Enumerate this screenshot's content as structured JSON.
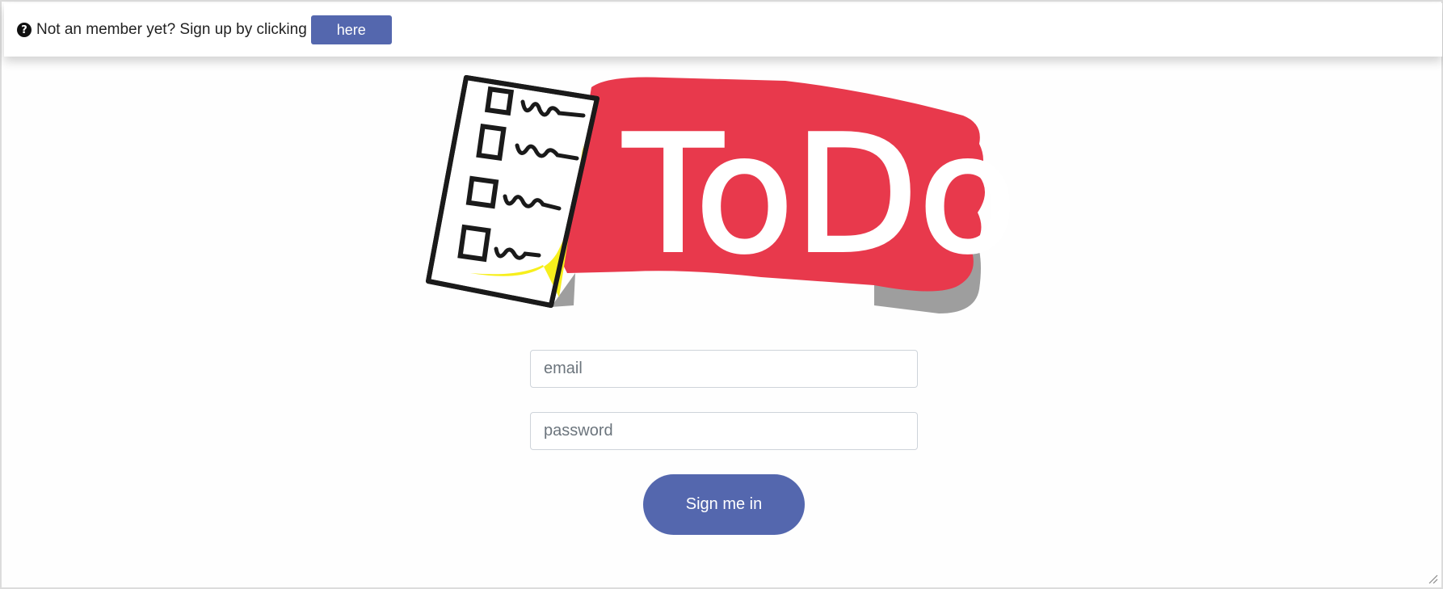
{
  "topbar": {
    "help_icon": "question-circle-icon",
    "text": "Not an member yet? Sign up by clicking",
    "here_label": "here"
  },
  "logo": {
    "text": "ToDo",
    "colors": {
      "banner": "#e8394c",
      "shadow": "#9e9e9e",
      "highlight": "#f7ef1c",
      "ink": "#1a1a1a"
    }
  },
  "form": {
    "email_placeholder": "email",
    "password_placeholder": "password",
    "submit_label": "Sign me in"
  },
  "colors": {
    "accent": "#5467ae"
  }
}
